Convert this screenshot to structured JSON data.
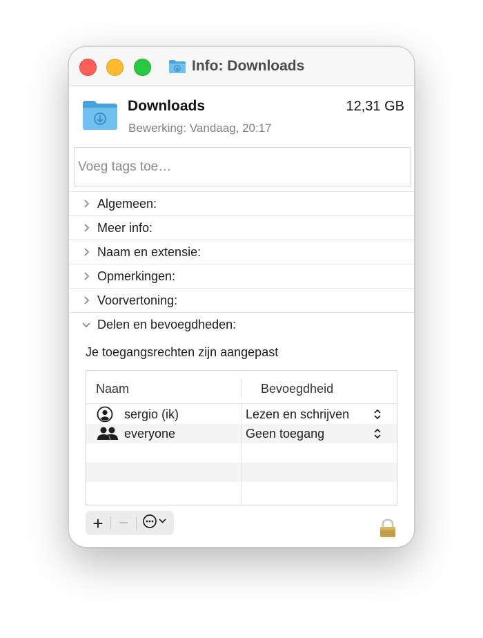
{
  "window": {
    "title": "Info: Downloads",
    "icons": {
      "title_icon": "folder-downloads-icon",
      "header_icon": "folder-downloads-icon",
      "lock_icon": "lock-icon"
    }
  },
  "file": {
    "name": "Downloads",
    "size": "12,31 GB",
    "modified_label": "Bewerking:",
    "modified_value": "Vandaag, 20:17"
  },
  "tags": {
    "placeholder": "Voeg tags toe…"
  },
  "sections": [
    {
      "label": "Algemeen:",
      "expanded": false
    },
    {
      "label": "Meer info:",
      "expanded": false
    },
    {
      "label": "Naam en extensie:",
      "expanded": false
    },
    {
      "label": "Opmerkingen:",
      "expanded": false
    },
    {
      "label": "Voorvertoning:",
      "expanded": false
    },
    {
      "label": "Delen en bevoegdheden:",
      "expanded": true
    }
  ],
  "sharing": {
    "note": "Je toegangsrechten zijn aangepast",
    "columns": {
      "name": "Naam",
      "permission": "Bevoegdheid"
    },
    "rows": [
      {
        "user": "sergio (ik)",
        "icon": "user-icon",
        "permission": "Lezen en schrijven"
      },
      {
        "user": "everyone",
        "icon": "group-icon",
        "permission": "Geen toegang"
      }
    ]
  },
  "toolbar": {
    "add_label": "+",
    "remove_label": "−",
    "action_icon": "ellipsis-circle-icon"
  },
  "colors": {
    "close": "#fe5f57",
    "minimize": "#febc2e",
    "zoom": "#28c840",
    "folder": "#5cb5e8",
    "lock": "#c8a24a"
  }
}
